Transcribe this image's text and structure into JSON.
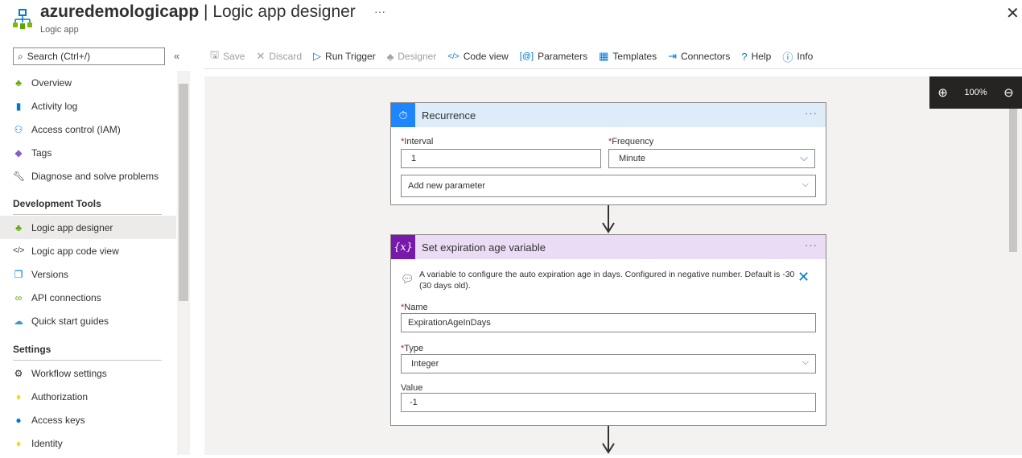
{
  "header": {
    "app_name": "azuredemologicapp",
    "separator": " | ",
    "page": "Logic app designer",
    "subtitle": "Logic app",
    "more": "···",
    "close": "✕"
  },
  "sidebar": {
    "search_placeholder": "Search (Ctrl+/)",
    "collapse": "«",
    "items_top": [
      {
        "label": "Overview",
        "icon": "logic-app-icon"
      },
      {
        "label": "Activity log",
        "icon": "activity-log-icon"
      },
      {
        "label": "Access control (IAM)",
        "icon": "people-icon"
      },
      {
        "label": "Tags",
        "icon": "tag-icon"
      },
      {
        "label": "Diagnose and solve problems",
        "icon": "wrench-icon"
      }
    ],
    "section_dev": "Development Tools",
    "items_dev": [
      {
        "label": "Logic app designer",
        "icon": "logic-app-icon",
        "selected": true
      },
      {
        "label": "Logic app code view",
        "icon": "code-icon"
      },
      {
        "label": "Versions",
        "icon": "versions-icon"
      },
      {
        "label": "API connections",
        "icon": "link-icon"
      },
      {
        "label": "Quick start guides",
        "icon": "cloud-icon"
      }
    ],
    "section_settings": "Settings",
    "items_settings": [
      {
        "label": "Workflow settings",
        "icon": "gear-icon"
      },
      {
        "label": "Authorization",
        "icon": "key-icon"
      },
      {
        "label": "Access keys",
        "icon": "refresh-key-icon"
      },
      {
        "label": "Identity",
        "icon": "identity-icon"
      }
    ]
  },
  "toolbar": {
    "save": "Save",
    "discard": "Discard",
    "run_trigger": "Run Trigger",
    "designer": "Designer",
    "code_view": "Code view",
    "parameters": "Parameters",
    "templates": "Templates",
    "connectors": "Connectors",
    "help": "Help",
    "info": "Info"
  },
  "zoom": {
    "level": "100%"
  },
  "recurrence": {
    "title": "Recurrence",
    "more": "···",
    "interval_label": "Interval",
    "interval_value": "1",
    "frequency_label": "Frequency",
    "frequency_value": "Minute",
    "add_param": "Add new parameter"
  },
  "variable": {
    "title": "Set expiration age variable",
    "more": "···",
    "comment": "A variable to configure the auto expiration age in days. Configured in negative number. Default is -30 (30 days old).",
    "name_label": "Name",
    "name_value": "ExpirationAgeInDays",
    "type_label": "Type",
    "type_value": "Integer",
    "value_label": "Value",
    "value_value": "-1"
  },
  "colors": {
    "accent": "#0078d4",
    "recurrence_header": "#deecf9",
    "variable_header": "#eadcf5",
    "variable_icon": "#7719aa"
  }
}
